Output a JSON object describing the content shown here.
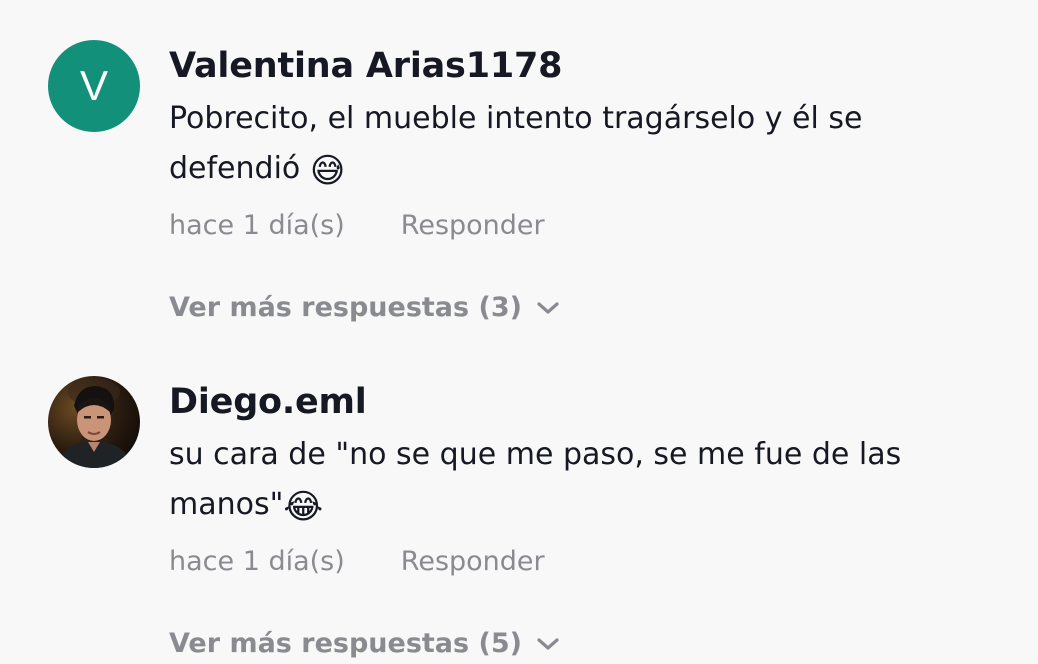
{
  "comments": [
    {
      "avatar_letter": "V",
      "avatar_color": "#13907a",
      "username": "Valentina Arias1178",
      "text_line1": "Pobrecito, el mueble intento tragárselo y él se",
      "text_line2": "defendió ",
      "emoji": "😅",
      "time": "hace 1 día(s)",
      "reply_label": "Responder",
      "more_replies": "Ver más respuestas (3)"
    },
    {
      "username": "Diego.eml",
      "text_line1": "su cara de \"no se que me paso, se me fue de las",
      "text_line2": "manos\"",
      "emoji": "😂",
      "time": "hace 1 día(s)",
      "reply_label": "Responder",
      "more_replies": "Ver más respuestas (5)"
    }
  ]
}
